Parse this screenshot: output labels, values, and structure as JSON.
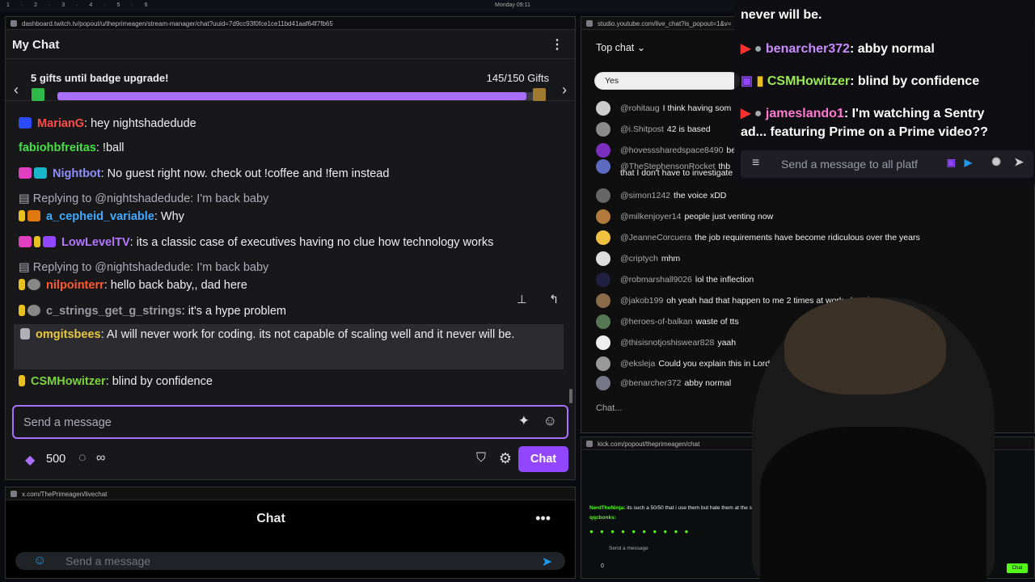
{
  "topbar": {
    "workspaces": "1 · 2 · 3 · 4 · 5 · 6",
    "clock": "Monday 09:11"
  },
  "twitch": {
    "url": "dashboard.twitch.tv/popout/u/theprimeagen/stream-manager/chat?uuid=7d9cc93f0fce1ce11bd41aaf64f7fb65",
    "title": "My Chat",
    "gift_goal": "5 gifts until badge upgrade!",
    "gift_count": "145/150 Gifts",
    "gift_progress": 0.9667,
    "messages": [
      {
        "user": "MarianG",
        "color": "#ff4a4a",
        "text": ": hey nightshadedude"
      },
      {
        "user": "fabiohbfreitas",
        "color": "#44e044",
        "text": ": !ball"
      },
      {
        "user": "Nightbot",
        "color": "#8f8fff",
        "text": ": No guest right now. check out !coffee and !fem instead"
      },
      {
        "reply": "Replying to @nightshadedude: I'm back baby"
      },
      {
        "user": "a_cepheid_variable",
        "color": "#3fa9ff",
        "text": ": Why"
      },
      {
        "user": "LowLevelTV",
        "color": "#b478ff",
        "text": ": its a classic case of executives having no clue how technology works"
      },
      {
        "reply": "Replying to @nightshadedude: I'm back baby"
      },
      {
        "user": "nilpointerr",
        "color": "#ff5a2e",
        "text": ": hello back baby,, dad here"
      },
      {
        "user": "c_strings_get_g_strings",
        "color": "#9a9aa0",
        "text": ": it's a hype problem"
      },
      {
        "user": "omgitsbees",
        "color": "#e8c83e",
        "text": ": AI will never work for coding. its not capable of scaling well and it never will be."
      },
      {
        "user": "CSMHowitzer",
        "color": "#7bd43c",
        "text": ": blind by confidence"
      }
    ],
    "input_placeholder": "Send a message",
    "points": "500",
    "infinity": "∞",
    "chat_button": "Chat"
  },
  "x": {
    "url": "x.com/ThePrimeagen/livechat",
    "title": "Chat",
    "more": "•••",
    "input_placeholder": "Send a message"
  },
  "youtube": {
    "url": "studio.youtube.com/live_chat?is_popout=1&v=",
    "header": "Top chat",
    "poll_option": "Yes",
    "rows": [
      {
        "author": "@rohitaug",
        "text": "I think having som",
        "color": "#cccccc"
      },
      {
        "author": "@i.Shitpost",
        "text": "42 is based",
        "color": "#8a8a8a"
      },
      {
        "author": "@hovesssharedspace8490",
        "text": "be",
        "color": "#7b2fbf"
      },
      {
        "author": "@TheStephensonRocket",
        "text": "thb",
        "text2": "that I don't have to investigate",
        "color": "#5c6bc0"
      },
      {
        "author": "@simon1242",
        "text": "the voice xDD",
        "color": "#666666"
      },
      {
        "author": "@milkenjoyer14",
        "text": "people just venting now",
        "color": "#b07a3a"
      },
      {
        "author": "@JeanneCorcuera",
        "text": "the job requirements have become ridiculous over the years",
        "color": "#f0c040"
      },
      {
        "author": "@criptych",
        "text": "mhm",
        "color": "#dddddd"
      },
      {
        "author": "@robmarshall9026",
        "text": "lol the inflection",
        "color": "#202040"
      },
      {
        "author": "@jakob199",
        "text": "oh yeah had that happen to me 2 times at work already",
        "color": "#8a6b4a"
      },
      {
        "author": "@heroes-of-balkan",
        "text": "waste of tts",
        "color": "#557755"
      },
      {
        "author": "@thisisnotjoshiswear828",
        "text": "yaah",
        "color": "#eeeeee"
      },
      {
        "author": "@eksleja",
        "text": "Could you explain this in Lord of",
        "color": "#999999"
      },
      {
        "author": "@benarcher372",
        "text": "abby normal",
        "color": "#777788"
      }
    ],
    "input_placeholder": "Chat..."
  },
  "kick": {
    "url": "kick.com/popout/theprimeagen/chat",
    "msg_user": "NerdTheNinja:",
    "msg_text": "its such a 50/50 that i use them but hate them at the same tim",
    "msg2_user": "qqcbonks:",
    "input_placeholder": "Send a message",
    "count": "0",
    "chat_button": "Chat"
  },
  "overlay": {
    "line0": "never will be.",
    "lines": [
      {
        "user": "benarcher372",
        "color": "#c98cff",
        "text": ": abby normal",
        "platform": "youtube"
      },
      {
        "user": "CSMHowitzer",
        "color": "#9bea54",
        "text": ": blind by confidence",
        "platform": "twitch"
      },
      {
        "user": "jameslando1",
        "color": "#ff7ad0",
        "text": ": I'm watching a Sentry",
        "platform": "youtube"
      }
    ],
    "line_cont": "ad... featuring Prime on a Prime video??",
    "input_placeholder": "Send a message to all platf"
  }
}
